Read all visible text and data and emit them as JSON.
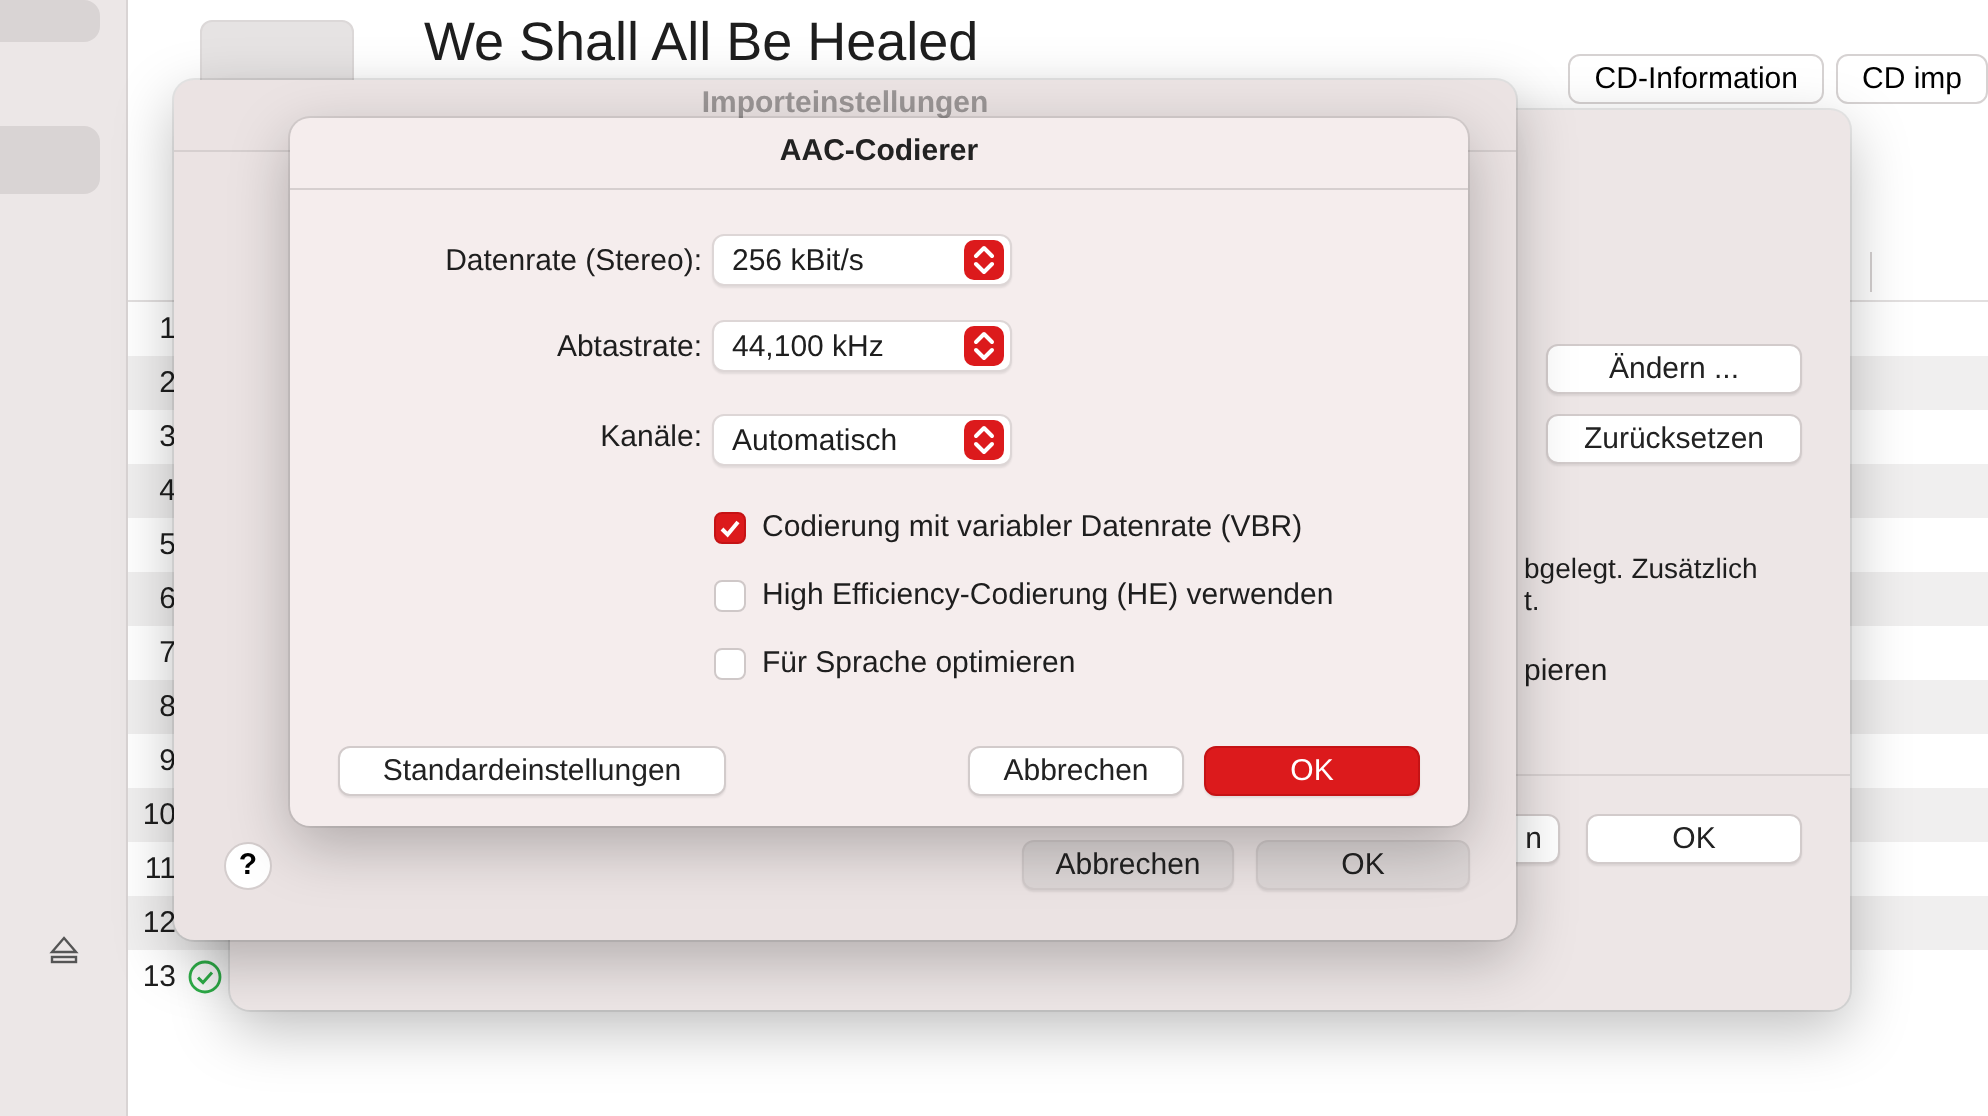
{
  "album": {
    "title": "We Shall All Be Healed",
    "buttons": [
      "CD-Information",
      "CD imp"
    ]
  },
  "tracks": [
    {
      "number": "1"
    },
    {
      "number": "2"
    },
    {
      "number": "3"
    },
    {
      "number": "4"
    },
    {
      "number": "5"
    },
    {
      "number": "6"
    },
    {
      "number": "7"
    },
    {
      "number": "8"
    },
    {
      "number": "9"
    },
    {
      "number": "10"
    },
    {
      "number": "11"
    },
    {
      "number": "12"
    },
    {
      "number": "13",
      "done": true
    }
  ],
  "back_dialog": {
    "buttons": [
      "Ändern ...",
      "Zurücksetzen"
    ],
    "text_lines": [
      "bgelegt. Zusätzlich",
      "t."
    ],
    "option": "pieren",
    "footer_buttons": [
      "n",
      "OK"
    ]
  },
  "import_dialog": {
    "title": "Importeinstellungen",
    "help": "?",
    "buttons": [
      "Abbrechen",
      "OK"
    ]
  },
  "encoder": {
    "title": "AAC-Codierer",
    "fields": [
      {
        "label": "Datenrate (Stereo):",
        "value": "256 kBit/s"
      },
      {
        "label": "Abtastrate:",
        "value": "44,100 kHz"
      },
      {
        "label": "Kanäle:",
        "value": "Automatisch"
      }
    ],
    "options": [
      {
        "label": "Codierung mit variabler Datenrate (VBR)",
        "checked": true
      },
      {
        "label": "High Efficiency-Codierung (HE) verwenden",
        "checked": false
      },
      {
        "label": "Für Sprache optimieren",
        "checked": false
      }
    ],
    "buttons": [
      {
        "label": "Standardeinstellungen",
        "kind": "plain"
      },
      {
        "label": "Abbrechen",
        "kind": "plain"
      },
      {
        "label": "OK",
        "kind": "default"
      }
    ]
  }
}
